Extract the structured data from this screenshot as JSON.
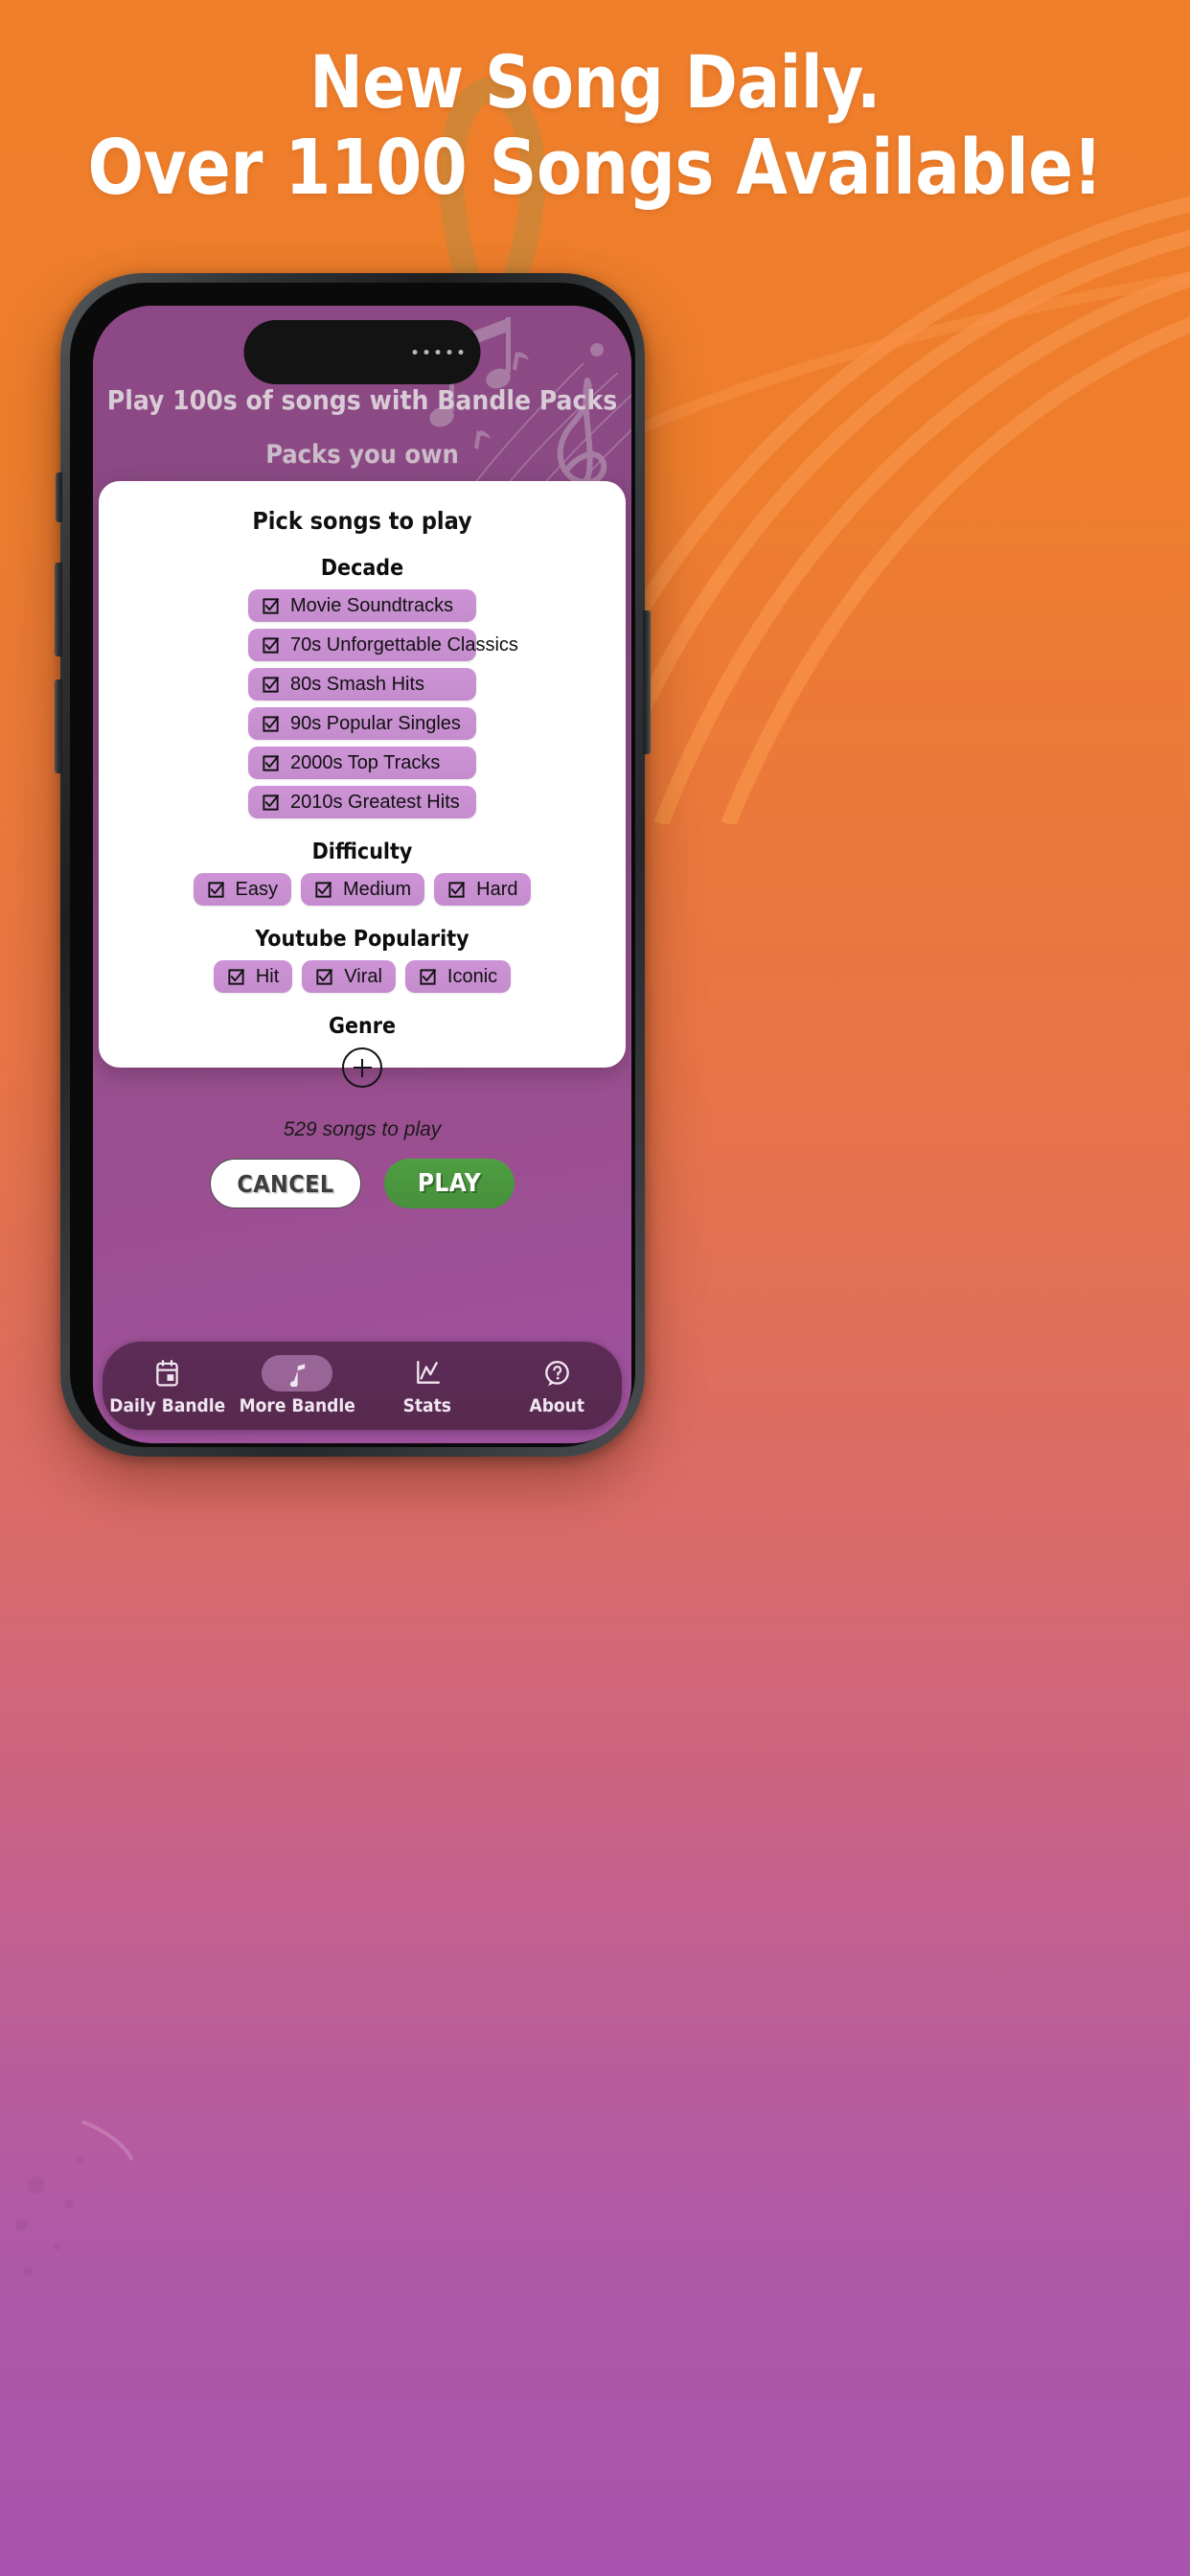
{
  "promo": {
    "headline_line1": "New Song Daily.",
    "headline_line2": "Over 1100 Songs Available!",
    "bg_top_color": "#F07F2B",
    "bg_bottom_color": "#A954AE"
  },
  "app": {
    "header_title": "Play 100s of songs with Bandle Packs",
    "subtitle": "Packs you own",
    "screen_bg_color": "#8c4985"
  },
  "modal": {
    "title": "Pick songs to play",
    "sections": {
      "decade": {
        "label": "Decade",
        "options": [
          {
            "label": "Movie Soundtracks",
            "checked": true
          },
          {
            "label": "70s Unforgettable Classics",
            "checked": true
          },
          {
            "label": "80s Smash Hits",
            "checked": true
          },
          {
            "label": "90s Popular Singles",
            "checked": true
          },
          {
            "label": "2000s Top Tracks",
            "checked": true
          },
          {
            "label": "2010s Greatest Hits",
            "checked": true
          }
        ]
      },
      "difficulty": {
        "label": "Difficulty",
        "options": [
          {
            "label": "Easy",
            "checked": true
          },
          {
            "label": "Medium",
            "checked": true
          },
          {
            "label": "Hard",
            "checked": true
          }
        ]
      },
      "youtube_popularity": {
        "label": "Youtube Popularity",
        "options": [
          {
            "label": "Hit",
            "checked": true
          },
          {
            "label": "Viral",
            "checked": true
          },
          {
            "label": "Iconic",
            "checked": true
          }
        ]
      },
      "genre": {
        "label": "Genre",
        "add_icon": "plus-icon"
      }
    },
    "songs_to_play": "529 songs to play",
    "cancel_label": "CANCEL",
    "play_label": "PLAY",
    "chip_color": "#c88fd1",
    "play_color": "#4e9e42"
  },
  "tabbar": {
    "items": [
      {
        "label": "Daily Bandle",
        "icon": "calendar-icon",
        "active": false
      },
      {
        "label": "More Bandle",
        "icon": "music-note-icon",
        "active": true
      },
      {
        "label": "Stats",
        "icon": "chart-icon",
        "active": false
      },
      {
        "label": "About",
        "icon": "question-bubble-icon",
        "active": false
      }
    ]
  }
}
